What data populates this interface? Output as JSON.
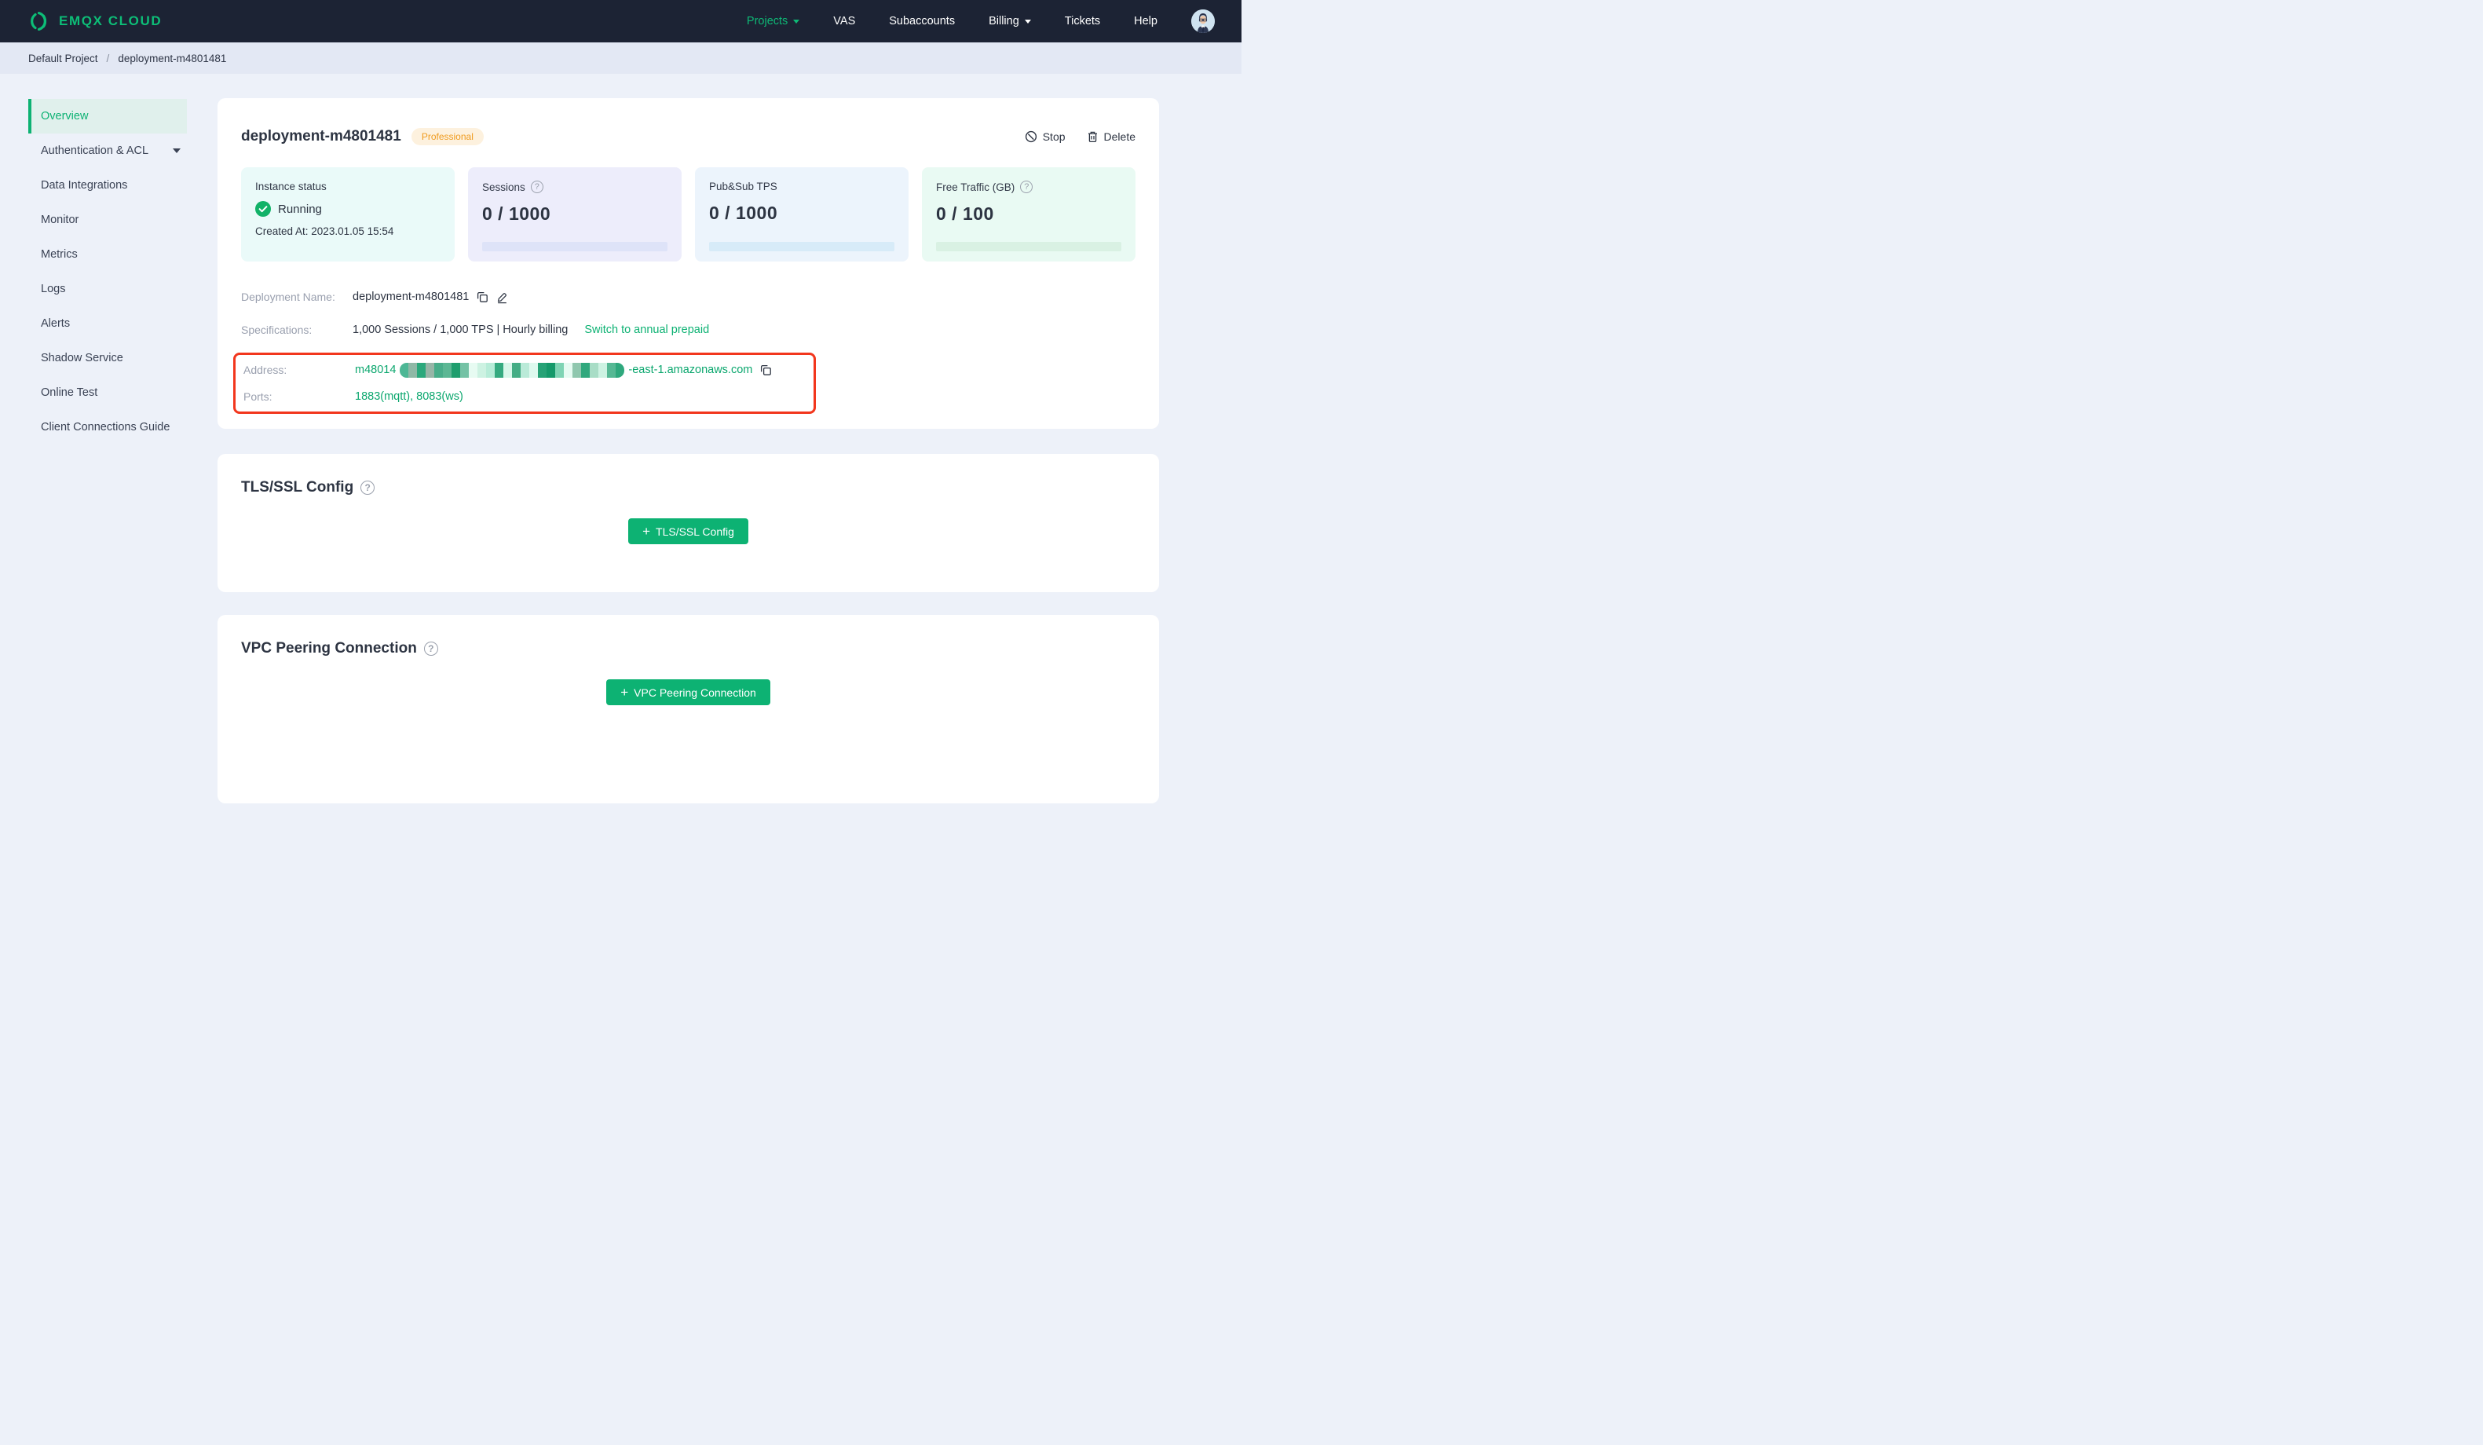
{
  "navbar": {
    "brand": "EMQX CLOUD",
    "items": [
      {
        "label": "Projects"
      },
      {
        "label": "VAS"
      },
      {
        "label": "Subaccounts"
      },
      {
        "label": "Billing"
      },
      {
        "label": "Tickets"
      },
      {
        "label": "Help"
      }
    ]
  },
  "breadcrumb": {
    "project": "Default Project",
    "separator": "/",
    "current": "deployment-m4801481"
  },
  "sidebar": {
    "items": [
      {
        "label": "Overview"
      },
      {
        "label": "Authentication & ACL"
      },
      {
        "label": "Data Integrations"
      },
      {
        "label": "Monitor"
      },
      {
        "label": "Metrics"
      },
      {
        "label": "Logs"
      },
      {
        "label": "Alerts"
      },
      {
        "label": "Shadow Service"
      },
      {
        "label": "Online Test"
      },
      {
        "label": "Client Connections Guide"
      }
    ]
  },
  "deployment": {
    "title": "deployment-m4801481",
    "plan_badge": "Professional",
    "stop_label": "Stop",
    "delete_label": "Delete",
    "stats": [
      {
        "label": "Instance status",
        "status": "Running",
        "created": "Created At: 2023.01.05 15:54"
      },
      {
        "label": "Sessions",
        "value": "0 / 1000"
      },
      {
        "label": "Pub&Sub TPS",
        "value": "0 / 1000"
      },
      {
        "label": "Free Traffic (GB)",
        "value": "0 / 100"
      }
    ],
    "info": {
      "name_label": "Deployment Name:",
      "name_value": "deployment-m4801481",
      "spec_label": "Specifications:",
      "spec_value": "1,000 Sessions / 1,000 TPS | Hourly billing",
      "spec_link": "Switch to annual prepaid",
      "address_label": "Address:",
      "address_prefix": "m48014",
      "address_suffix": "-east-1.amazonaws.com",
      "ports_label": "Ports:",
      "ports_value": "1883(mqtt), 8083(ws)"
    }
  },
  "tls": {
    "title": "TLS/SSL Config",
    "button_label": "TLS/SSL Config"
  },
  "vpc": {
    "title": "VPC Peering Connection",
    "button_label": "VPC Peering Connection"
  },
  "glyphs": {
    "help": "?",
    "plus": "+"
  },
  "colors": {
    "accent_green": "#0db273",
    "brand_green": "#0dbd77",
    "navbar_bg": "#1c2334",
    "badge_orange_text": "#f09b1e",
    "badge_orange_bg": "#fdf1de",
    "annotation_red": "#f2361d",
    "status_running_green": "#12b268",
    "stat_bg_instance": "#eafaf9",
    "stat_bg_sessions": "#ededfb",
    "stat_bg_tps": "#ecf4fc",
    "stat_bg_traffic": "#e9faf3",
    "progress_sessions": "#dee3f8",
    "progress_tps": "#d7ebf8",
    "progress_traffic": "#d9f1e3"
  },
  "redaction_colors": [
    "#4db795",
    "#8fb8a6",
    "#2ba87c",
    "#97b5a7",
    "#49ad8a",
    "#5cb794",
    "#1f9e6e",
    "#74c2a5",
    "#e7fbf2",
    "#cdf2e2",
    "#b7ecd8",
    "#35aa80",
    "#d8f7ea",
    "#44ad85",
    "#baead8",
    "#def9ee",
    "#27a276",
    "#15996a",
    "#7fd4b4",
    "#e6fbf2",
    "#8fc7ae",
    "#31a87d",
    "#a8ddc6",
    "#cdf2e2",
    "#56b894",
    "#2fa87d"
  ]
}
